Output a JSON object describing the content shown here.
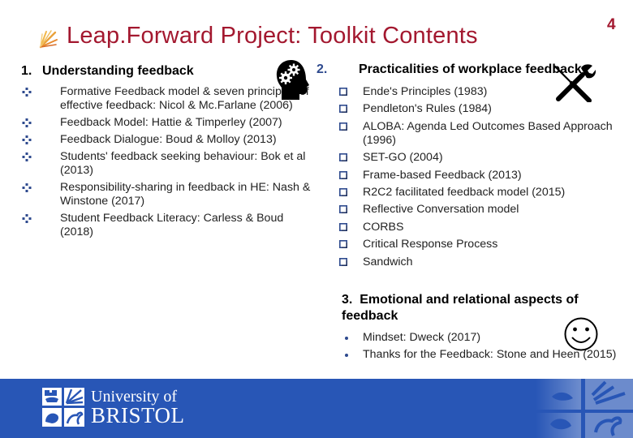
{
  "slide": {
    "number": "4",
    "title": "Leap.Forward Project: Toolkit Contents"
  },
  "section1": {
    "number": "1.",
    "heading": "Understanding feedback",
    "items": [
      "Formative Feedback model & seven principles of effective feedback: Nicol & Mc.Farlane (2006)",
      "Feedback Model: Hattie & Timperley (2007)",
      "Feedback Dialogue: Boud & Molloy (2013)",
      "Students' feedback seeking behaviour: Bok et al (2013)",
      "Responsibility-sharing in feedback in HE: Nash & Winstone (2017)",
      "Student Feedback Literacy: Carless & Boud (2018)"
    ]
  },
  "section2": {
    "number": "2.",
    "heading": "Practicalities of workplace feedback",
    "items": [
      "Ende's Principles (1983)",
      "Pendleton's Rules (1984)",
      "ALOBA: Agenda Led Outcomes Based Approach (1996)",
      "SET-GO (2004)",
      "Frame-based Feedback (2013)",
      "R2C2 facilitated feedback model (2015)",
      "Reflective Conversation model",
      "CORBS",
      "Critical Response Process",
      "Sandwich"
    ]
  },
  "section3": {
    "number": "3.",
    "heading": "Emotional and relational aspects of feedback",
    "items": [
      "Mindset: Dweck (2017)",
      "Thanks for the Feedback: Stone and Heen (2015)"
    ]
  },
  "footer": {
    "logo_line1": "University of",
    "logo_line2": "BRISTOL"
  },
  "icons": {
    "title": "leapforward-logo-icon",
    "section1": "head-gears-icon",
    "section2": "tools-icon",
    "section3": "smiley-face-icon"
  },
  "colors": {
    "title": "#a3182f",
    "bullet": "#2e4a8e",
    "footer": "#2856b6"
  }
}
